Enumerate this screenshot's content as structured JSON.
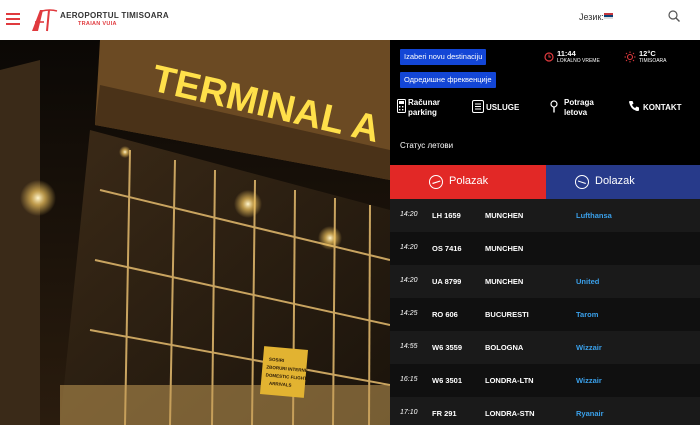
{
  "header": {
    "logo_name": "AEROPORTUL TIMISOARA",
    "logo_sub": "TRAIAN VUIA",
    "language_label": "Језик:",
    "accent_color": "#e03a3e"
  },
  "panel": {
    "btn_destination": "Izaberi novu destinaciju",
    "btn_frequency": "Одредишне фреквенције",
    "time_value": "11:44",
    "time_label": "LOKALNO VREME",
    "temp_value": "12°C",
    "temp_label": "TIMISOARA",
    "link_parking_1": "Računar",
    "link_parking_2": "parking",
    "link_services": "USLUGE",
    "link_lost_1": "Potraga",
    "link_lost_2": "letova",
    "link_contact": "KONTAKT",
    "status_title": "Статус летови"
  },
  "tabs": {
    "departures": "Polazak",
    "arrivals": "Dolazak",
    "departures_color": "#e22826",
    "arrivals_color": "#273a8a"
  },
  "flights": [
    {
      "time": "14:20",
      "flight": "LH 1659",
      "destination": "MUNCHEN",
      "airline": "Lufthansa"
    },
    {
      "time": "14:20",
      "flight": "OS 7416",
      "destination": "MUNCHEN",
      "airline": ""
    },
    {
      "time": "14:20",
      "flight": "UA 8799",
      "destination": "MUNCHEN",
      "airline": "United"
    },
    {
      "time": "14:25",
      "flight": "RO 606",
      "destination": "BUCURESTI",
      "airline": "Tarom"
    },
    {
      "time": "14:55",
      "flight": "W6 3559",
      "destination": "BOLOGNA",
      "airline": "Wizzair"
    },
    {
      "time": "16:15",
      "flight": "W6 3501",
      "destination": "LONDRA-LTN",
      "airline": "Wizzair"
    },
    {
      "time": "17:10",
      "flight": "FR 291",
      "destination": "LONDRA-STN",
      "airline": "Ryanair"
    }
  ],
  "photo": {
    "sign_text": "TERMINAL A",
    "small_sign_1": "SOSIRI",
    "small_sign_2": "ZBORURI INTERNE",
    "small_sign_3": "DOMESTIC FLIGHTS",
    "small_sign_4": "ARRIVALS"
  }
}
